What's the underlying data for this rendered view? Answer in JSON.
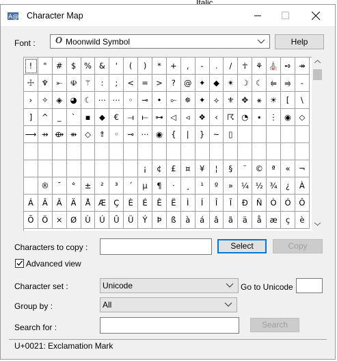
{
  "background_text": "Italic",
  "window": {
    "title": "Character Map",
    "controls": {
      "minimize": "minimize",
      "maximize": "maximize",
      "close": "close"
    }
  },
  "font": {
    "label": "Font :",
    "selected": "Moonwild Symbol",
    "icon": "opentype-icon",
    "help_label": "Help"
  },
  "grid_rows": [
    [
      "!",
      "\"",
      "#",
      "$",
      "%",
      "&",
      "'",
      "(",
      ")",
      "*",
      "+",
      ",",
      "-",
      ".",
      "/",
      "☥",
      "⚘",
      "⛪",
      "➺",
      "↠"
    ],
    [
      "☩",
      "♆",
      "⤜",
      "☫",
      "⚚",
      ":",
      ";",
      "<",
      "=",
      ">",
      "?",
      "@",
      "✦",
      "◆",
      "✴",
      "☽",
      "☾",
      "⥢",
      "⥤",
      "-"
    ],
    [
      "›",
      "✧",
      "◈",
      "◕",
      "☾",
      "⋯",
      "⋯",
      "◦",
      "⊸",
      "•",
      "⟜",
      "✵",
      "✦",
      "⟡",
      "⚜",
      "✥",
      "⚹",
      "☀",
      "[",
      "\\"
    ],
    [
      "]",
      "^",
      "_",
      "`",
      "▪",
      "◆",
      "€",
      "⟞",
      "⟝",
      "⊶",
      "◁",
      "◃",
      "❖",
      "‹",
      "☈",
      "◔",
      "∙",
      "⋮",
      "◉",
      "◇"
    ],
    [
      "⟶",
      "⇸",
      "⟴",
      "⇻",
      "◇",
      "⥉",
      "◦",
      "⊸",
      "⋯",
      "◉",
      "{",
      "|",
      "}",
      "~",
      "▯",
      "",
      "",
      "",
      "",
      ""
    ],
    [
      "",
      "",
      "",
      "",
      "",
      "",
      "",
      "",
      "",
      "",
      "",
      "",
      "",
      "",
      "",
      "",
      "",
      "",
      "",
      ""
    ],
    [
      "",
      "",
      "",
      "",
      "",
      "",
      "",
      "",
      "¡",
      "¢",
      "£",
      "¤",
      "¥",
      "¦",
      "§",
      "¨",
      "©",
      "ª",
      "«",
      "¬"
    ],
    [
      "",
      "®",
      "¯",
      "°",
      "±",
      "²",
      "³",
      "´",
      "µ",
      "¶",
      "·",
      "¸",
      "¹",
      "º",
      "»",
      "¼",
      "½",
      "¾",
      "¿",
      "À"
    ],
    [
      "Á",
      "Â",
      "Ã",
      "Ä",
      "Å",
      "Æ",
      "Ç",
      "È",
      "É",
      "Ê",
      "Ë",
      "Ì",
      "Í",
      "Î",
      "Ï",
      "Ð",
      "Ñ",
      "Ò",
      "Ó",
      "Ô"
    ],
    [
      "Õ",
      "Ö",
      "×",
      "Ø",
      "Ù",
      "Ú",
      "Û",
      "Ü",
      "Ý",
      "Þ",
      "ß",
      "à",
      "á",
      "â",
      "ã",
      "ä",
      "å",
      "æ",
      "ç",
      "è"
    ]
  ],
  "chars_to_copy": {
    "label": "Characters to copy :",
    "value": "",
    "select_label": "Select",
    "copy_label": "Copy"
  },
  "advanced_view": {
    "label": "Advanced view",
    "checked": true
  },
  "character_set": {
    "label": "Character set :",
    "selected": "Unicode"
  },
  "goto_unicode": {
    "label": "Go to Unicode :",
    "value": ""
  },
  "group_by": {
    "label": "Group by :",
    "selected": "All"
  },
  "search": {
    "label": "Search for :",
    "value": "",
    "button_label": "Search"
  },
  "status": "U+0021: Exclamation Mark"
}
